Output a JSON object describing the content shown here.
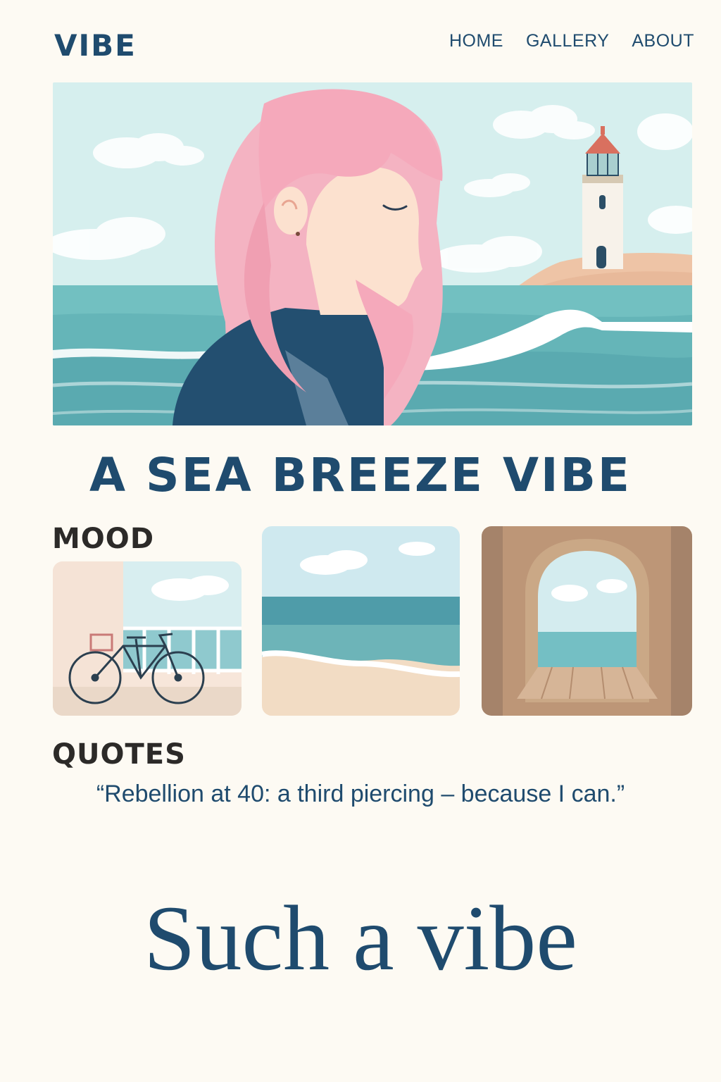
{
  "header": {
    "logo": "VIBE",
    "nav": [
      {
        "label": "HOME"
      },
      {
        "label": "GALLERY"
      },
      {
        "label": "ABOUT"
      }
    ]
  },
  "hero": {
    "image": "pink-haired-girl-seaside-lighthouse"
  },
  "main": {
    "title": "A SEA BREEZE VIBE",
    "mood": {
      "label": "MOOD",
      "tiles": [
        "bicycle-by-railing",
        "beach-waves",
        "archway-sea-view"
      ]
    },
    "quotes": {
      "label": "QUOTES",
      "text": "“Rebellion at 40: a third piercing – because I can.”"
    },
    "tagline": "Such a vibe"
  },
  "colors": {
    "background": "#fdfaf3",
    "navy": "#1f4b6e",
    "sea": "#6fbcbf",
    "sky": "#d6efee",
    "hair": "#f4b3c2"
  }
}
